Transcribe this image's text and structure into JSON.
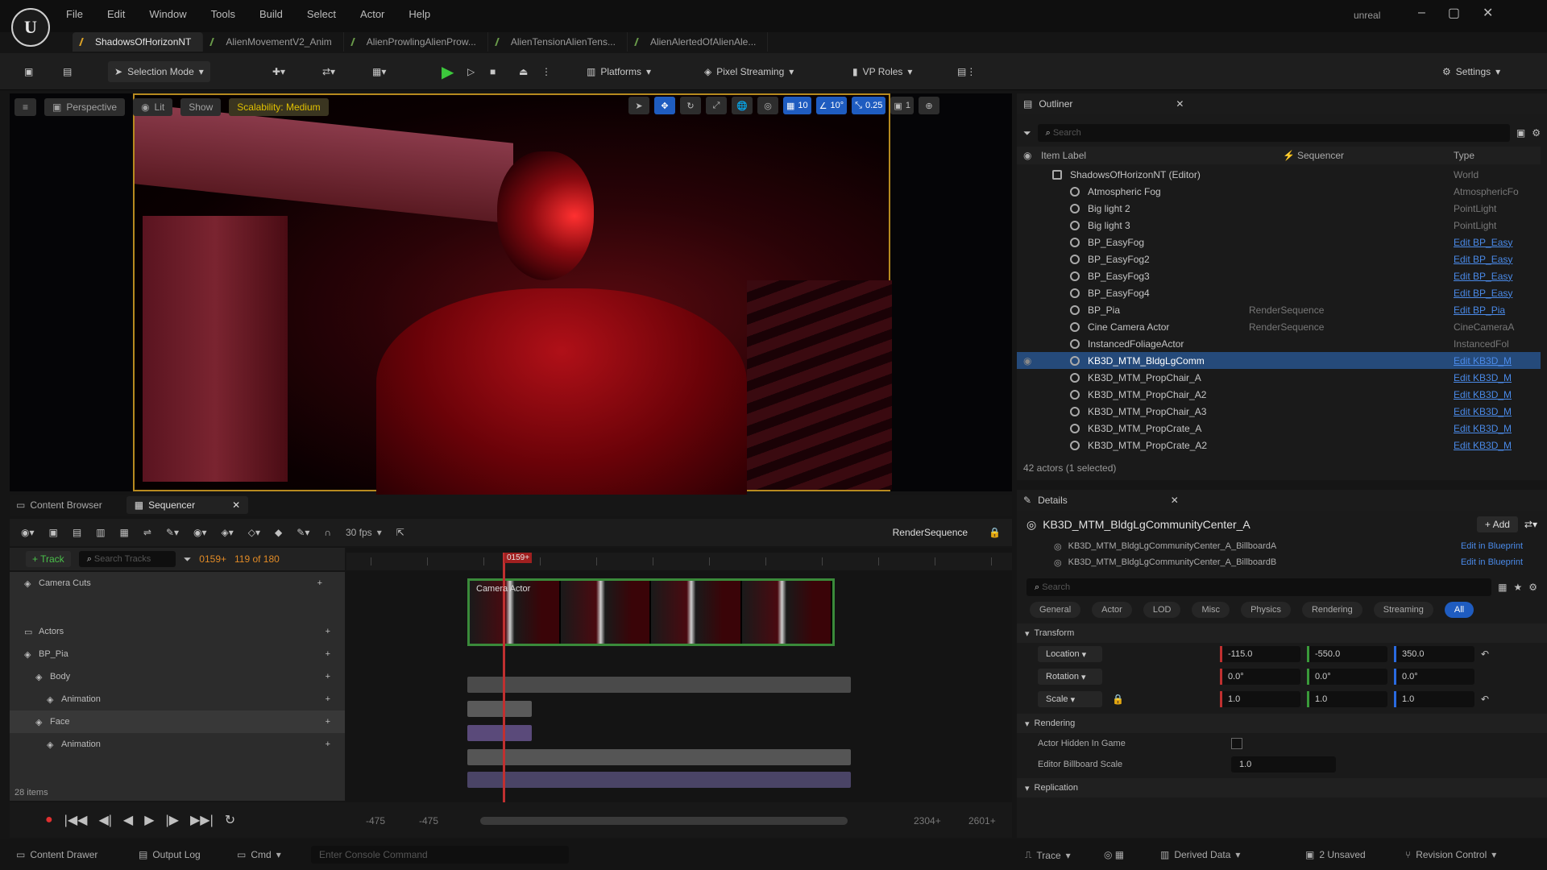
{
  "app": {
    "title": "unreal"
  },
  "menu": [
    "File",
    "Edit",
    "Window",
    "Tools",
    "Build",
    "Select",
    "Actor",
    "Help"
  ],
  "tabs": [
    {
      "label": "ShadowsOfHorizonNT",
      "active": true
    },
    {
      "label": "AlienMovementV2_Anim"
    },
    {
      "label": "AlienProwlingAlienProw..."
    },
    {
      "label": "AlienTensionAlienTens..."
    },
    {
      "label": "AlienAlertedOfAlienAle..."
    }
  ],
  "toolbar": {
    "selection_mode": "Selection Mode",
    "platforms": "Platforms",
    "pixel_streaming": "Pixel Streaming",
    "vp_roles": "VP Roles",
    "settings": "Settings"
  },
  "viewport": {
    "perspective": "Perspective",
    "lit": "Lit",
    "show": "Show",
    "scalability": "Scalability: Medium",
    "grid_val": "10",
    "angle_val": "10°",
    "scale_val": "0.25",
    "cam_speed": "1"
  },
  "outliner": {
    "title": "Outliner",
    "search_placeholder": "Search",
    "col_label": "Item Label",
    "col_seq": "Sequencer",
    "col_type": "Type",
    "rows": [
      {
        "label": "ShadowsOfHorizonNT (Editor)",
        "seq": "",
        "type": "World",
        "root": true
      },
      {
        "label": "Atmospheric Fog",
        "seq": "",
        "type": "AtmosphericFo",
        "grey": true
      },
      {
        "label": "Big light 2",
        "seq": "",
        "type": "PointLight",
        "grey": true
      },
      {
        "label": "Big light 3",
        "seq": "",
        "type": "PointLight",
        "grey": true
      },
      {
        "label": "BP_EasyFog",
        "seq": "",
        "type": "Edit BP_Easy"
      },
      {
        "label": "BP_EasyFog2",
        "seq": "",
        "type": "Edit BP_Easy"
      },
      {
        "label": "BP_EasyFog3",
        "seq": "",
        "type": "Edit BP_Easy"
      },
      {
        "label": "BP_EasyFog4",
        "seq": "",
        "type": "Edit BP_Easy"
      },
      {
        "label": "BP_Pia",
        "seq": "RenderSequence",
        "type": "Edit BP_Pia"
      },
      {
        "label": "Cine Camera Actor",
        "seq": "RenderSequence",
        "type": "CineCameraA",
        "grey": true
      },
      {
        "label": "InstancedFoliageActor",
        "seq": "",
        "type": "InstancedFol",
        "grey": true
      },
      {
        "label": "KB3D_MTM_BldgLgComm",
        "seq": "",
        "type": "Edit KB3D_M",
        "selected": true
      },
      {
        "label": "KB3D_MTM_PropChair_A",
        "seq": "",
        "type": "Edit KB3D_M"
      },
      {
        "label": "KB3D_MTM_PropChair_A2",
        "seq": "",
        "type": "Edit KB3D_M"
      },
      {
        "label": "KB3D_MTM_PropChair_A3",
        "seq": "",
        "type": "Edit KB3D_M"
      },
      {
        "label": "KB3D_MTM_PropCrate_A",
        "seq": "",
        "type": "Edit KB3D_M"
      },
      {
        "label": "KB3D_MTM_PropCrate_A2",
        "seq": "",
        "type": "Edit KB3D_M"
      }
    ],
    "footer": "42 actors (1 selected)"
  },
  "details": {
    "title": "Details",
    "actor": "KB3D_MTM_BldgLgCommunityCenter_A",
    "add": "+ Add",
    "components": [
      {
        "label": "KB3D_MTM_BldgLgCommunityCenter_A_BillboardA",
        "link": "Edit in Blueprint"
      },
      {
        "label": "KB3D_MTM_BldgLgCommunityCenter_A_BillboardB",
        "link": "Edit in Blueprint"
      }
    ],
    "search_placeholder": "Search",
    "filters": [
      "General",
      "Actor",
      "LOD",
      "Misc",
      "Physics",
      "Rendering",
      "Streaming",
      "All"
    ],
    "transform_header": "Transform",
    "location_label": "Location",
    "rotation_label": "Rotation",
    "scale_label": "Scale",
    "location": [
      "-115.0",
      "-550.0",
      "350.0"
    ],
    "rotation": [
      "0.0°",
      "0.0°",
      "0.0°"
    ],
    "scale": [
      "1.0",
      "1.0",
      "1.0"
    ],
    "rendering_header": "Rendering",
    "hidden_label": "Actor Hidden In Game",
    "billboard_label": "Editor Billboard Scale",
    "billboard_value": "1.0",
    "replication_header": "Replication"
  },
  "bottom": {
    "content_browser": "Content Browser",
    "sequencer": "Sequencer",
    "fps": "30 fps",
    "render_sequence": "RenderSequence",
    "add_track": "+ Track",
    "search_placeholder": "Search Tracks",
    "current_frame": "0159+",
    "frame_range": "119 of 180",
    "playhead": "0159+",
    "tracks": [
      {
        "label": "Camera Cuts",
        "indent": 0
      },
      {
        "label": "Actors",
        "indent": 0
      },
      {
        "label": "BP_Pia",
        "indent": 0
      },
      {
        "label": "Body",
        "indent": 1
      },
      {
        "label": "Animation",
        "indent": 2
      },
      {
        "label": "Face",
        "indent": 1
      },
      {
        "label": "Animation",
        "indent": 2
      }
    ],
    "clip_label": "Camera Actor",
    "items_count": "28 items",
    "range_start": "-475",
    "range_start2": "-475",
    "range_end": "2304+",
    "range_end2": "2601+"
  },
  "status": {
    "content_drawer": "Content Drawer",
    "output_log": "Output Log",
    "cmd": "Cmd",
    "console_placeholder": "Enter Console Command",
    "trace": "Trace",
    "derived_data": "Derived Data",
    "unsaved": "2 Unsaved",
    "revision": "Revision Control"
  }
}
